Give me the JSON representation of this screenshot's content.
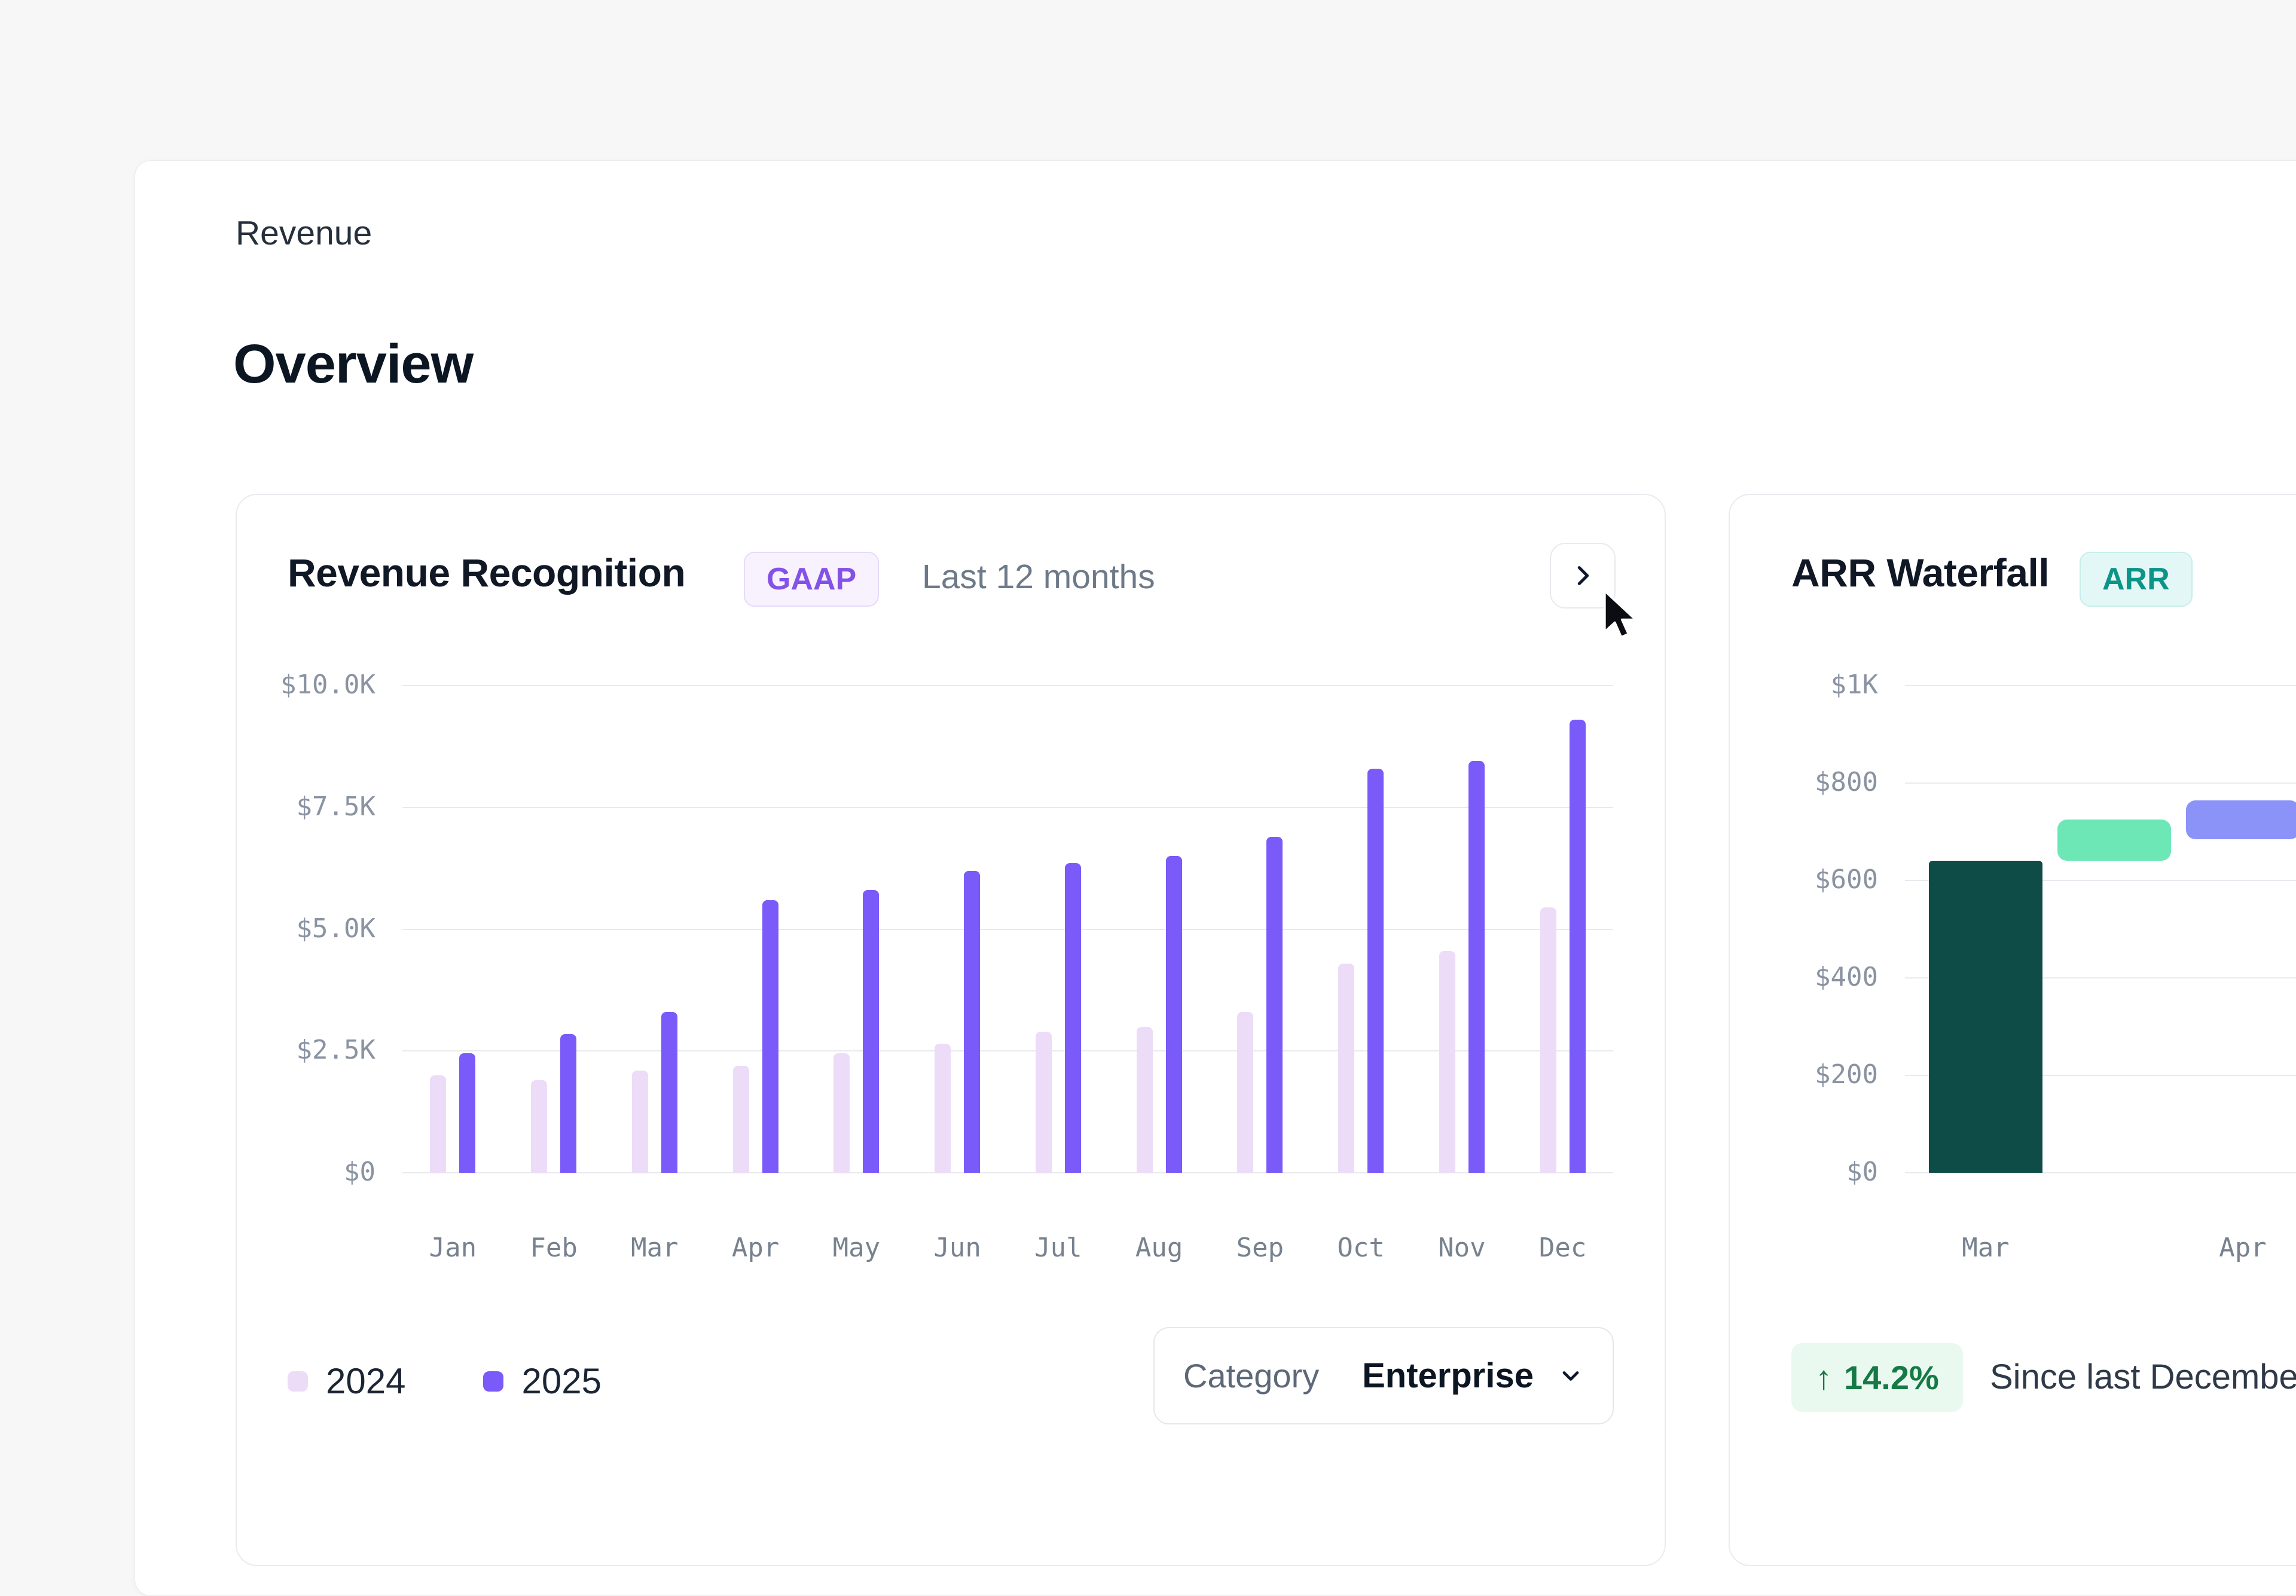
{
  "page": {
    "breadcrumb": "Revenue",
    "title": "Overview"
  },
  "revenue_card": {
    "title": "Revenue Recognition",
    "badge": "GAAP",
    "subtitle": "Last 12 months",
    "category_label": "Category",
    "category_value": "Enterprise"
  },
  "arr_card": {
    "title": "ARR Waterfall",
    "badge": "ARR",
    "delta_arrow": "↑",
    "delta_value": "14.2%",
    "delta_caption": "Since last December"
  },
  "icons": {
    "expand": "chevron-right",
    "category_dropdown": "chevron-down",
    "delta": "arrow-up"
  },
  "colors": {
    "accent_purple": "#7a5af8",
    "light_purple": "#ecdcf8",
    "badge_purple": "#8452e8",
    "badge_teal": "#0d9488",
    "dark_teal": "#0d4c47",
    "mint_green": "#6ee7b7",
    "periwinkle": "#8b92f8",
    "positive_green": "#157a45",
    "grid": "#e8eaee"
  },
  "chart_data": [
    {
      "type": "bar",
      "title": "Revenue Recognition",
      "categories": [
        "Jan",
        "Feb",
        "Mar",
        "Apr",
        "May",
        "Jun",
        "Jul",
        "Aug",
        "Sep",
        "Oct",
        "Nov",
        "Dec"
      ],
      "series": [
        {
          "name": "2024",
          "color": "#ecdcf8",
          "values": [
            2000,
            1900,
            2100,
            2200,
            2450,
            2650,
            2900,
            3000,
            3300,
            4300,
            4550,
            5450
          ]
        },
        {
          "name": "2025",
          "color": "#7a5af8",
          "values": [
            2450,
            2850,
            3300,
            5600,
            5800,
            6200,
            6350,
            6500,
            6900,
            8300,
            8450,
            9300
          ]
        }
      ],
      "ylim": [
        0,
        10000
      ],
      "yticks": [
        0,
        2500,
        5000,
        7500,
        10000
      ],
      "ytick_labels": [
        "$0",
        "$2.5K",
        "$5.0K",
        "$7.5K",
        "$10.0K"
      ],
      "grid": true,
      "legend_position": "bottom-left"
    },
    {
      "type": "waterfall",
      "title": "ARR Waterfall",
      "bars": [
        {
          "label": "Mar",
          "from": 0,
          "to": 640,
          "color": "#0d4c47"
        },
        {
          "label": "",
          "from": 640,
          "to": 725,
          "color": "#6ee7b7"
        },
        {
          "label": "Apr",
          "from": 685,
          "to": 765,
          "color": "#8b92f8"
        }
      ],
      "ylim": [
        0,
        1000
      ],
      "yticks": [
        0,
        200,
        400,
        600,
        800,
        1000
      ],
      "ytick_labels": [
        "$0",
        "$200",
        "$400",
        "$600",
        "$800",
        "$1K"
      ],
      "grid": true
    }
  ]
}
